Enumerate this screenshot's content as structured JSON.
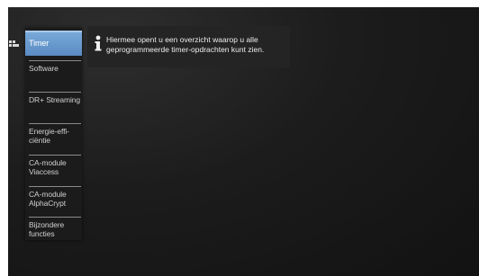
{
  "menu": {
    "items": [
      {
        "label": "Timer",
        "active": true
      },
      {
        "label": "Software"
      },
      {
        "label": "DR+ Streaming"
      },
      {
        "label": "Energie-effi- ciëntie"
      },
      {
        "label": "CA-module Viaccess"
      },
      {
        "label": "CA-module AlphaCrypt"
      },
      {
        "label": "Bijzondere functies"
      }
    ]
  },
  "info": {
    "icon": "info-icon",
    "text": "Hiermee opent u een overzicht waarop u alle geprogrammeerde timer-opdrachten kunt zien."
  },
  "colors": {
    "background": "#1c1c1c",
    "accent": "#6a9ad0",
    "text": "#cfcfcf"
  }
}
